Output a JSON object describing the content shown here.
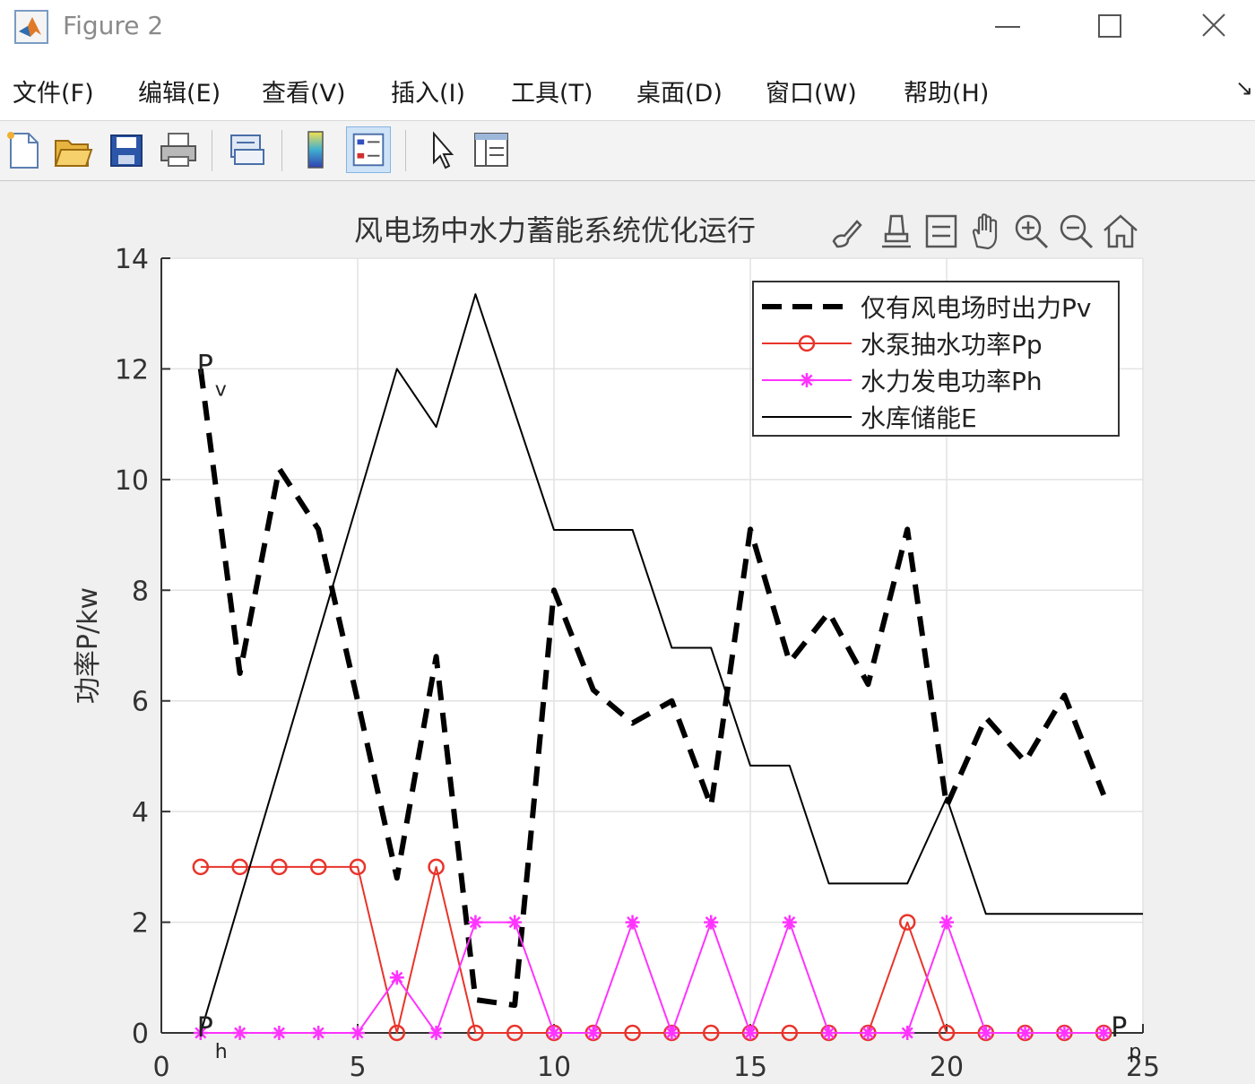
{
  "window": {
    "title": "Figure 2"
  },
  "menu": [
    {
      "label": "文件(F)"
    },
    {
      "label": "编辑(E)"
    },
    {
      "label": "查看(V)"
    },
    {
      "label": "插入(I)"
    },
    {
      "label": "工具(T)"
    },
    {
      "label": "桌面(D)"
    },
    {
      "label": "窗口(W)"
    },
    {
      "label": "帮助(H)"
    }
  ],
  "toolbar": {
    "icons": [
      "new-figure-icon",
      "open-file-icon",
      "save-icon",
      "print-icon",
      "link-plot-icon",
      "colorbar-icon",
      "legend-icon",
      "pointer-icon",
      "property-inspector-icon"
    ]
  },
  "axes_toolbar": {
    "icons": [
      "brush-icon",
      "data-tips-icon",
      "pan-icon",
      "zoom-in-icon",
      "zoom-out-icon",
      "home-icon"
    ]
  },
  "chart_data": {
    "type": "line",
    "title": "风电场中水力蓄能系统优化运行",
    "xlabel": "",
    "ylabel": "功率P/kw",
    "xlim": [
      0,
      25
    ],
    "ylim": [
      0,
      14
    ],
    "xticks": [
      0,
      5,
      10,
      15,
      20,
      25
    ],
    "yticks": [
      0,
      2,
      4,
      6,
      8,
      10,
      12,
      14
    ],
    "grid": true,
    "legend_position": "top-right",
    "x": [
      1,
      2,
      3,
      4,
      5,
      6,
      7,
      8,
      9,
      10,
      11,
      12,
      13,
      14,
      15,
      16,
      17,
      18,
      19,
      20,
      21,
      22,
      23,
      24
    ],
    "series": [
      {
        "name": "仅有风电场时出力Pv",
        "style": "dashed",
        "color": "#000000",
        "values": [
          12.0,
          6.5,
          10.2,
          9.1,
          6.0,
          2.8,
          6.8,
          0.6,
          0.5,
          8.0,
          6.2,
          5.6,
          6.0,
          4.1,
          9.1,
          6.7,
          7.6,
          6.3,
          9.1,
          4.1,
          5.7,
          4.9,
          6.1,
          4.3
        ],
        "annotation": {
          "text": "P",
          "sub": "v"
        }
      },
      {
        "name": "水泵抽水功率Pp",
        "style": "solid-circle",
        "color": "#e8342b",
        "values": [
          3,
          3,
          3,
          3,
          3,
          0,
          3,
          0,
          0,
          0,
          0,
          0,
          0,
          0,
          0,
          0,
          0,
          0,
          2,
          0,
          0,
          0,
          0,
          0
        ],
        "annotation": {
          "text": "P",
          "sub": "p"
        }
      },
      {
        "name": "水力发电功率Ph",
        "style": "solid-star",
        "color": "#ff33ff",
        "values": [
          0,
          0,
          0,
          0,
          0,
          1,
          0,
          2,
          2,
          0,
          0,
          2,
          0,
          2,
          0,
          2,
          0,
          0,
          0,
          2,
          0,
          0,
          0,
          0
        ],
        "annotation": {
          "text": "P",
          "sub": "h"
        }
      },
      {
        "name": "水库储能E",
        "style": "solid",
        "color": "#000000",
        "x": [
          1,
          2,
          3,
          4,
          5,
          6,
          7,
          8,
          9,
          10,
          11,
          12,
          13,
          14,
          15,
          16,
          17,
          18,
          19,
          20,
          21,
          22,
          23,
          24,
          25
        ],
        "values": [
          0,
          2.4,
          4.8,
          7.2,
          9.6,
          12.0,
          10.95,
          13.35,
          11.22,
          9.09,
          9.09,
          9.09,
          6.96,
          6.96,
          4.83,
          4.83,
          2.7,
          2.7,
          2.7,
          4.25,
          2.15,
          2.15,
          2.15,
          2.15,
          2.15
        ]
      }
    ]
  }
}
